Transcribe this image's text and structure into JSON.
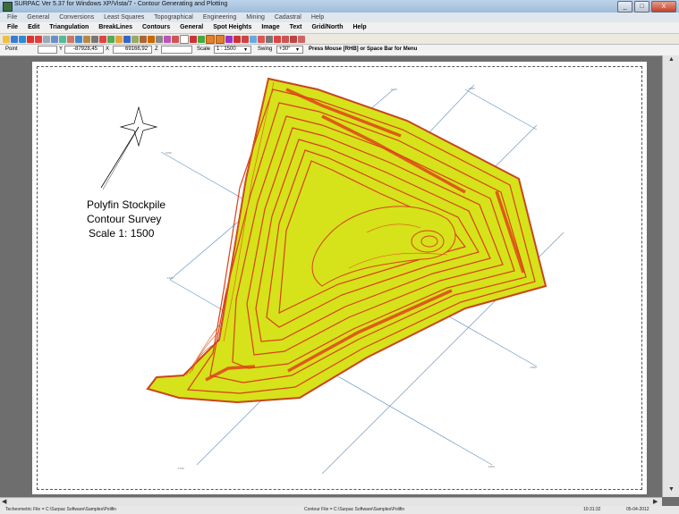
{
  "window": {
    "title": "SURPAC Ver 5.37 for Windows XP/Vista/7 - Contour Generating and Plotting",
    "buttons": [
      "_",
      "□",
      "X"
    ]
  },
  "menubar_secondary": [
    "File",
    "General",
    "Conversions",
    "Least Squares",
    "Topographical",
    "Engineering",
    "Mining",
    "Cadastral",
    "Help"
  ],
  "menubar_primary": [
    "File",
    "Edit",
    "Triangulation",
    "BreakLines",
    "Contours",
    "General",
    "Spot Heights",
    "Image",
    "Text",
    "Grid/North",
    "Help"
  ],
  "status": {
    "mode": "Point",
    "y_label": "Y",
    "y_value": "-87928,45",
    "x_label": "X",
    "x_value": "69166,92",
    "z_label": "Z",
    "scale_label": "Scale",
    "scale_value": "1 : 1500",
    "swing_label": "Swing",
    "swing_value": "+30°",
    "hint": "Press Mouse [RHB] or Space Bar for Menu"
  },
  "drawing": {
    "title_lines": [
      "Polyfin Stockpile",
      "Contour Survey",
      "Scale  1: 1500"
    ]
  },
  "bottom_status": {
    "left": "Techeometric File = C:\\Surpac Software\\Samples\\Polifin",
    "middle": "Contour File = C:\\Surpac Software\\Samples\\Polifin",
    "time": "10:31:32",
    "date": "05-04-2012"
  },
  "colors": {
    "surface_fill": "#d6e21a",
    "contour_line": "#d8401a",
    "grid_line": "#6f9ac8",
    "titlebar": "#a8c4e0"
  }
}
